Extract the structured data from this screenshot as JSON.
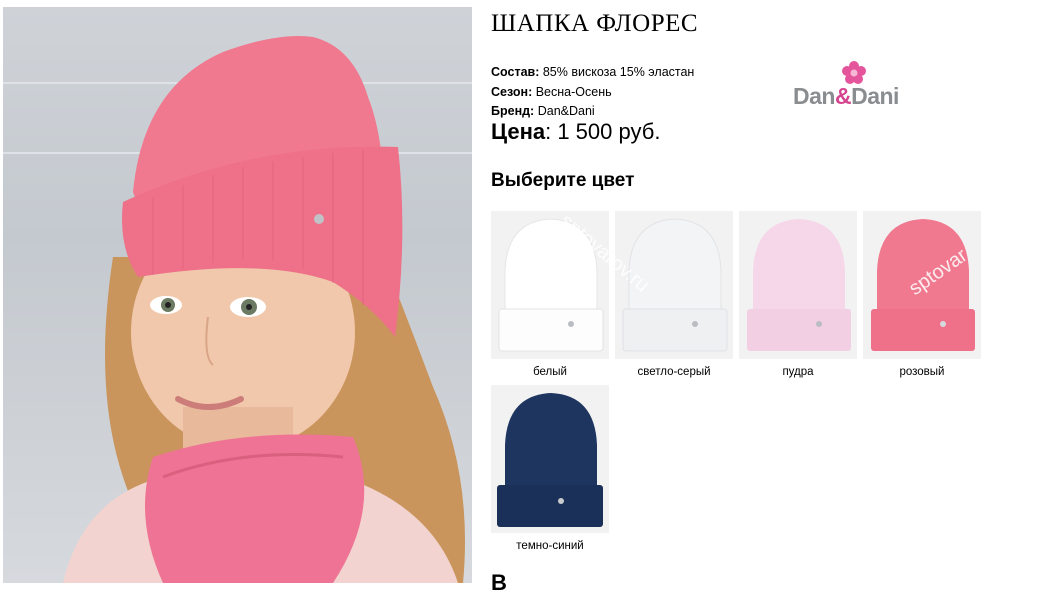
{
  "product": {
    "title": "ШАПКА ФЛОРЕС",
    "specs": [
      {
        "label": "Состав:",
        "value": "85% вискоза 15% эластан"
      },
      {
        "label": "Сезон:",
        "value": "Весна-Осень"
      },
      {
        "label": "Бренд:",
        "value": "Dan&Dani"
      }
    ],
    "price_label": "Цена",
    "price_value": ": 1 500 руб."
  },
  "brand": {
    "name_part1": "Dan",
    "amp": "&",
    "name_part2": "Dani",
    "flower_color": "#e4559c"
  },
  "color_picker": {
    "heading": "Выберите цвет",
    "options": [
      {
        "label": "белый",
        "color": "#ffffff"
      },
      {
        "label": "светло-серый",
        "color": "#f3f4f6"
      },
      {
        "label": "пудра",
        "color": "#f6d7e9"
      },
      {
        "label": "розовый",
        "color": "#f0798f"
      },
      {
        "label": "темно-синий",
        "color": "#1e3560"
      }
    ]
  },
  "watermarks": [
    "sptovarov.ru",
    "sptovar"
  ],
  "next_heading_fragment": "В"
}
